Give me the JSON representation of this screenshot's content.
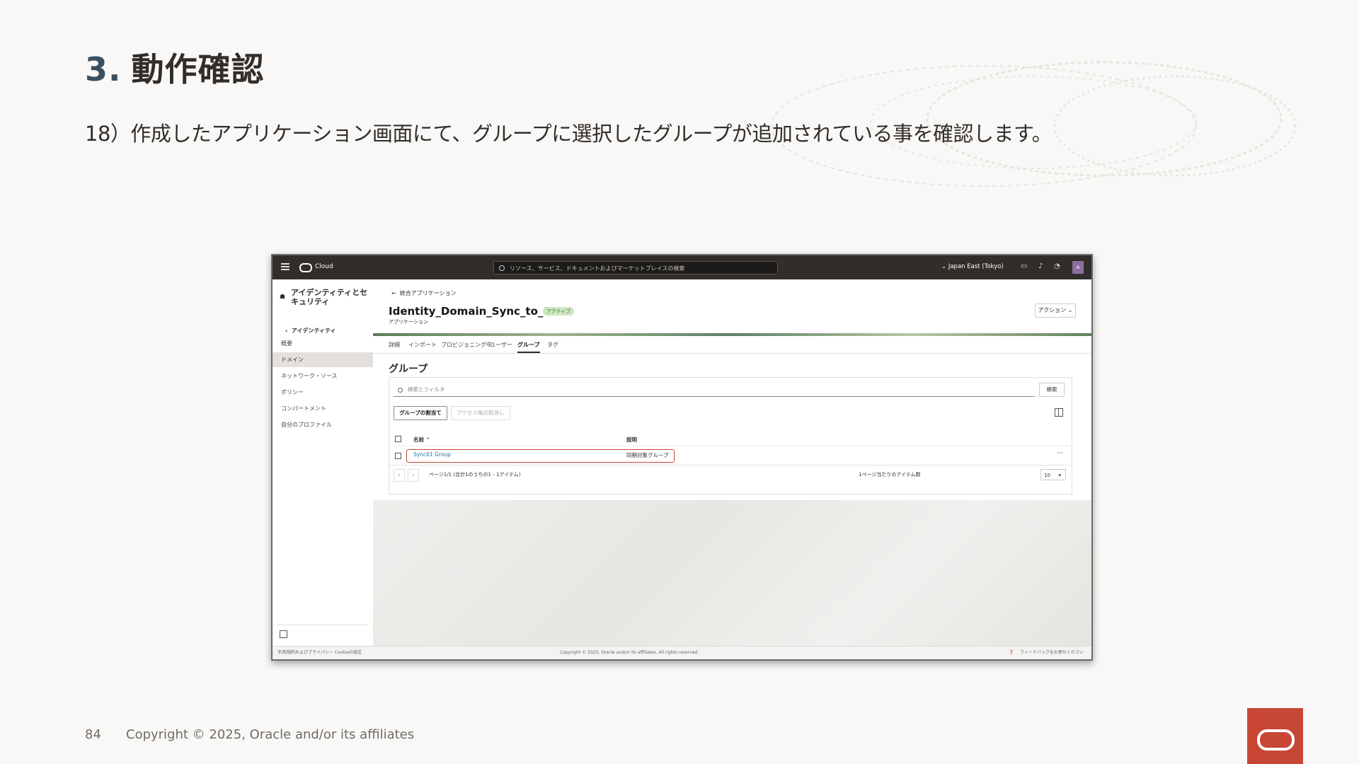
{
  "slide": {
    "title_num": "3.",
    "title": "動作確認",
    "description": "18）作成したアプリケーション画面にて、グループに選択したグループが追加されている事を確認します。",
    "page_number": "84",
    "copyright": "Copyright © 2025, Oracle and/or its affiliates",
    "accent_color": "#c74634"
  },
  "console": {
    "topbar": {
      "brand": "Cloud",
      "search_placeholder": "リソース、サービス、ドキュメントおよびマーケットプレイスの検索",
      "region": "Japan East (Tokyo)",
      "avatar": "A"
    },
    "sidebar": {
      "title": "アイデンティティとセキュリティ",
      "back": "アイデンティティ",
      "items": [
        "概要",
        "ドメイン",
        "ネットワーク・ソース",
        "ポリシー",
        "コンパートメント",
        "自分のプロファイル"
      ],
      "active_item": "ドメイン"
    },
    "breadcrumb": "統合アプリケーション",
    "app_title": "Identity_Domain_Sync_to_SP",
    "status_badge": "アクティブ",
    "app_subtitle": "アプリケーション",
    "actions_label": "アクション",
    "tabs": [
      "詳細",
      "インポート",
      "プロビジョニング中",
      "ユーザー",
      "グループ",
      "タグ"
    ],
    "active_tab": "グループ",
    "section_title": "グループ",
    "filter_placeholder": "検索とフィルタ",
    "search_button": "検索",
    "assign_button": "グループの割当て",
    "revoke_button": "アクセス権の取消し",
    "table": {
      "headers": [
        "名前",
        "説明"
      ],
      "rows": [
        {
          "name": "Sync01 Group",
          "description": "同期対象グループ"
        }
      ]
    },
    "pager": {
      "summary": "ページ1/1 (合計1のうちの1 - 1アイテム)",
      "per_page_label": "1ページ当たりのアイテム数",
      "per_page_value": "10"
    },
    "footer": {
      "left": "利用規約およびプライバシー   Cookieの設定",
      "center": "Copyright © 2025, Oracle and/or its affiliates. All rights reserved.",
      "right": "フィードバックをお寄せください"
    }
  }
}
